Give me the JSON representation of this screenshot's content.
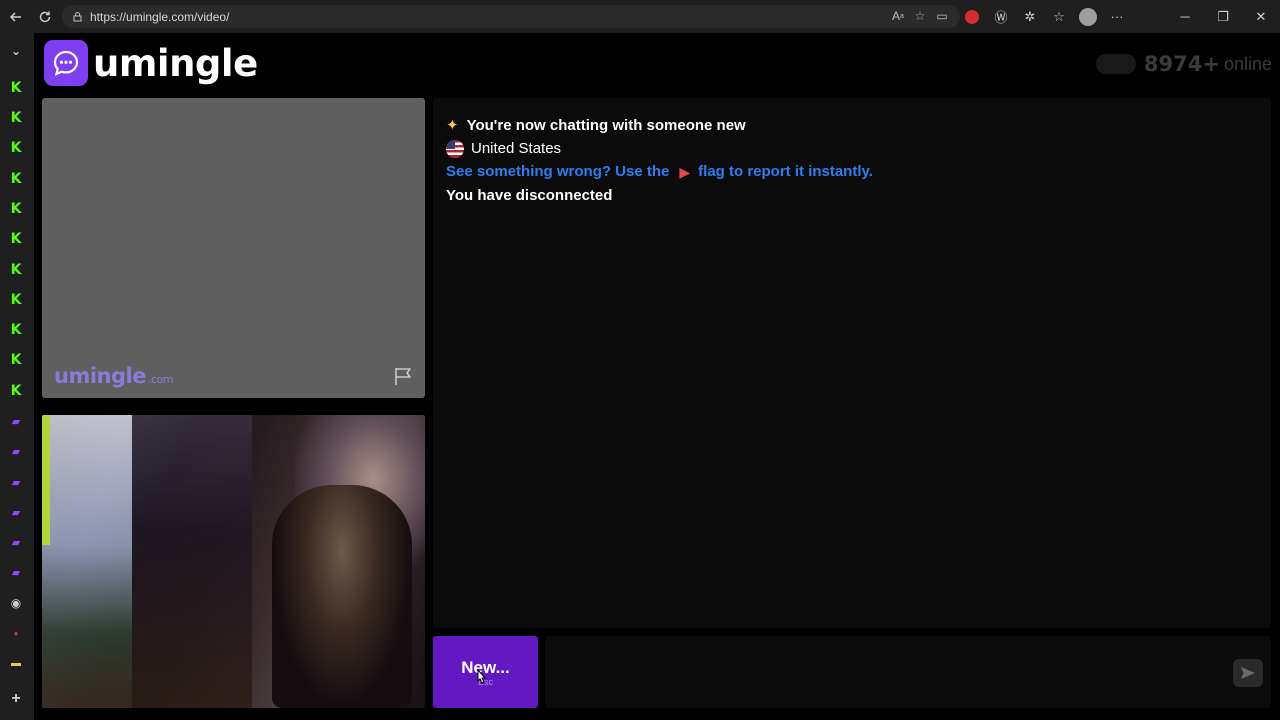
{
  "browser": {
    "url": "https://umingle.com/video/",
    "back_icon": "arrow-left-icon",
    "refresh_icon": "refresh-icon",
    "window_controls": [
      "minimize",
      "restore",
      "close"
    ]
  },
  "sidebar": {
    "kick_count": 11,
    "twitch_count": 6
  },
  "header": {
    "logo_text": "umingle",
    "online_count": "8974+",
    "online_label": "online"
  },
  "stranger_video": {
    "watermark": "umingle",
    "watermark_suffix": ".com"
  },
  "chat": {
    "msg_connected": "You're now chatting with someone new",
    "msg_country": "United States",
    "msg_report_prefix": "See something wrong? Use the",
    "msg_report_suffix": "flag to report it instantly.",
    "msg_disconnected": "You have disconnected"
  },
  "controls": {
    "new_label": "New...",
    "new_hint": "Esc"
  },
  "colors": {
    "brand_purple": "#7e3ff2",
    "button_purple": "#6418c3",
    "link_blue": "#2f7ef0",
    "kick_green": "#53fc18"
  }
}
